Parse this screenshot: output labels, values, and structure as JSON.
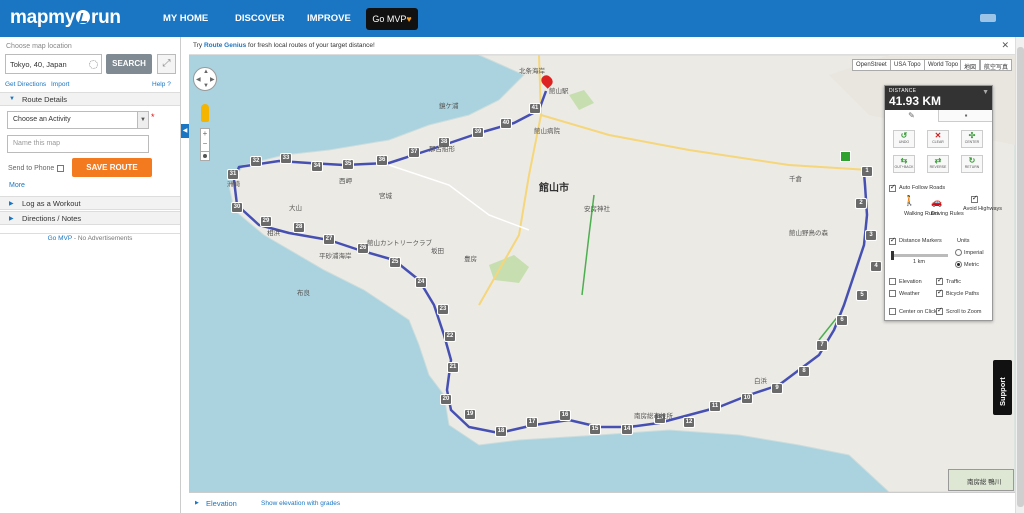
{
  "header": {
    "logo_left": "mapmy",
    "logo_right": "run",
    "nav": [
      "MY HOME",
      "DISCOVER",
      "IMPROVE"
    ],
    "mvp_label": "Go MVP"
  },
  "sidebar": {
    "location_label": "Choose map location",
    "location_value": "Tokyo, 40, Japan",
    "search_label": "SEARCH",
    "get_directions": "Get Directions",
    "import": "Import",
    "help": "Help",
    "route_details": "Route Details",
    "activity_select": "Choose an Activity",
    "name_placeholder": "Name this map",
    "send_to_phone": "Send to Phone",
    "save_route": "SAVE ROUTE",
    "more": "More",
    "log_workout": "Log as a Workout",
    "directions_notes": "Directions / Notes",
    "go_mvp": "Go MVP",
    "no_ads": " - No Advertisements"
  },
  "map": {
    "notice_prefix": "Try ",
    "notice_link": "Route Genius",
    "notice_suffix": " for fresh local routes of your target distance!",
    "map_types": [
      "OpenStreet",
      "USA Topo",
      "World Topo",
      "地図",
      "航空写真"
    ],
    "city_label": "館山市",
    "place_labels": [
      "北条海岸",
      "鏡ケ浦",
      "館山駅",
      "館山病院",
      "安房神社",
      "南房総市役所",
      "白浜",
      "千倉",
      "館山野鳥の森",
      "布良",
      "相浜",
      "大山",
      "西岬",
      "坂田",
      "洲崎",
      "平砂浦海岸",
      "館山カントリークラブ",
      "豊房",
      "宮城",
      "那古船形"
    ],
    "route_markers": [
      "1",
      "2",
      "3",
      "4",
      "5",
      "6",
      "7",
      "8",
      "9",
      "10",
      "11",
      "12",
      "13",
      "14",
      "15",
      "16",
      "17",
      "18",
      "19",
      "20",
      "21",
      "22",
      "23",
      "24",
      "25",
      "26",
      "27",
      "28",
      "29",
      "30",
      "31",
      "32",
      "33",
      "34",
      "35",
      "36",
      "37",
      "38",
      "39",
      "40",
      "41"
    ],
    "minimap_label": "南房総 鴨川"
  },
  "distance_panel": {
    "label": "DISTANCE",
    "value": "41.93 KM",
    "tools": [
      {
        "icon": "undo-icon",
        "label": "UNDO",
        "color": "#3a9b3a"
      },
      {
        "icon": "clear-icon",
        "label": "CLEAR",
        "color": "#cc2222"
      },
      {
        "icon": "center-icon",
        "label": "CENTER",
        "color": "#3a9b3a"
      },
      {
        "icon": "out-back-icon",
        "label": "OUT+BACK",
        "color": "#3a9b3a"
      },
      {
        "icon": "reverse-icon",
        "label": "REVERSE",
        "color": "#3a9b3a"
      },
      {
        "icon": "return-icon",
        "label": "RETURN",
        "color": "#3a9b3a"
      }
    ],
    "auto_follow": "Auto Follow Roads",
    "walking_rules": "Walking Rules",
    "driving_rules": "Driving Rules",
    "avoid_highways": "Avoid Highways",
    "distance_markers": "Distance Markers",
    "units_label": "Units",
    "imperial": "Imperial",
    "metric": "Metric",
    "slider_value": "1 km",
    "elevation": "Elevation",
    "traffic": "Traffic",
    "weather": "Weather",
    "bicycle_paths": "Bicycle Paths",
    "center_on_click": "Center on Click",
    "scroll_to_zoom": "Scroll to Zoom"
  },
  "bottom": {
    "elevation": "Elevation",
    "show_grades": "Show elevation with grades"
  },
  "support": "Support"
}
